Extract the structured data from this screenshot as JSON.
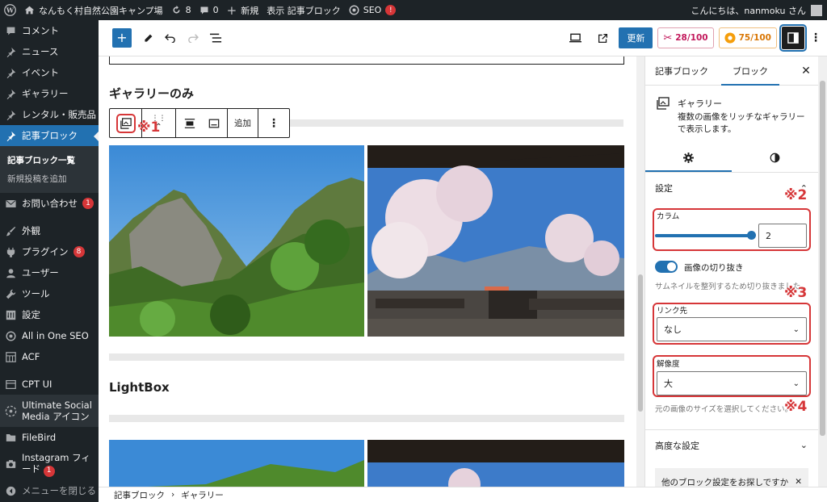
{
  "adminbar": {
    "site_name": "なんもく村自然公園キャンプ場",
    "updates_count": "8",
    "comments_count": "0",
    "new_label": "新規",
    "view_label": "表示 記事ブロック",
    "seo_label": "SEO",
    "seo_badge": "!",
    "greeting": "こんにちは、nanmoku さん"
  },
  "sidebar": {
    "items": [
      {
        "label": "コメント",
        "icon": "comment-icon"
      },
      {
        "label": "ニュース",
        "icon": "pin-icon"
      },
      {
        "label": "イベント",
        "icon": "pin-icon"
      },
      {
        "label": "ギャラリー",
        "icon": "pin-icon"
      },
      {
        "label": "レンタル・販売品",
        "icon": "pin-icon"
      },
      {
        "label": "記事ブロック",
        "icon": "pin-icon"
      }
    ],
    "submenu": [
      "記事ブロック一覧",
      "新規投稿を追加"
    ],
    "items2": [
      {
        "label": "お問い合わせ",
        "badge": "1",
        "icon": "mail-icon"
      },
      {
        "label": "外観",
        "icon": "brush-icon"
      },
      {
        "label": "プラグイン",
        "badge": "8",
        "icon": "plug-icon"
      },
      {
        "label": "ユーザー",
        "icon": "user-icon"
      },
      {
        "label": "ツール",
        "icon": "wrench-icon"
      },
      {
        "label": "設定",
        "icon": "settings-icon"
      },
      {
        "label": "All in One SEO",
        "icon": "aioseo-icon"
      },
      {
        "label": "ACF",
        "icon": "grid-icon"
      }
    ],
    "items3": [
      {
        "label": "CPT UI",
        "icon": "cpt-icon"
      },
      {
        "label": "Ultimate Social Media アイコン",
        "icon": "social-icon"
      },
      {
        "label": "FileBird",
        "icon": "folder-icon"
      },
      {
        "label": "Instagram フィード",
        "badge": "1",
        "icon": "camera-icon"
      }
    ],
    "collapse": "メニューを閉じる"
  },
  "header": {
    "update": "更新",
    "score1": "28/100",
    "score2": "75/100"
  },
  "canvas": {
    "heading1": "ギャラリーのみ",
    "heading2": "LightBox",
    "toolbar_add": "追加",
    "notes": {
      "n1": "※1",
      "n2": "※2",
      "n3": "※3",
      "n4": "※4"
    }
  },
  "breadcrumb": {
    "items": [
      "記事ブロック",
      "ギャラリー"
    ]
  },
  "inspector": {
    "tab_post": "記事ブロック",
    "tab_block": "ブロック",
    "block_title": "ギャラリー",
    "block_desc": "複数の画像をリッチなギャラリーで表示します。",
    "settings_title": "設定",
    "columns_label": "カラム",
    "columns_value": "2",
    "columns_fraction": 1.0,
    "crop_label": "画像の切り抜き",
    "crop_hint": "サムネイルを整列するため切り抜きました。",
    "link_label": "リンク先",
    "link_value": "なし",
    "res_label": "解像度",
    "res_value": "大",
    "res_hint": "元の画像のサイズを選択してください。",
    "advanced": "高度な設定",
    "help": "他のブロック設定をお探しですか"
  },
  "colors": {
    "accent": "#2271b1",
    "annotation": "#d63638",
    "admin_dark": "#1d2327"
  }
}
